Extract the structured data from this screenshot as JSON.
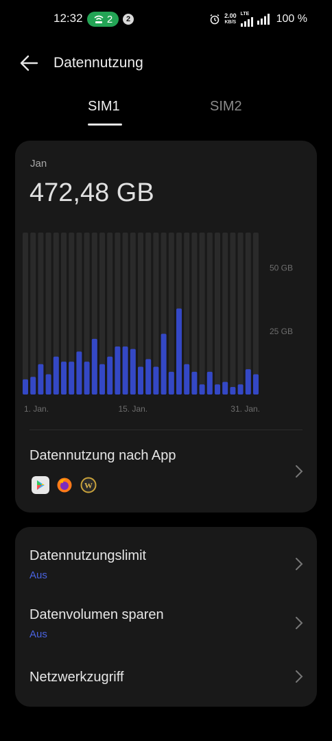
{
  "status_bar": {
    "time": "12:32",
    "hotspot_count": "2",
    "notification_count": "2",
    "speed_value": "2.00",
    "speed_unit": "KB/S",
    "network": "LTE",
    "battery": "100 %"
  },
  "header": {
    "title": "Datennutzung"
  },
  "tabs": [
    {
      "label": "SIM1",
      "selected": true
    },
    {
      "label": "SIM2",
      "selected": false
    }
  ],
  "usage": {
    "month": "Jan",
    "total": "472,48 GB"
  },
  "chart_data": {
    "type": "bar",
    "categories": [
      "1",
      "2",
      "3",
      "4",
      "5",
      "6",
      "7",
      "8",
      "9",
      "10",
      "11",
      "12",
      "13",
      "14",
      "15",
      "16",
      "17",
      "18",
      "19",
      "20",
      "21",
      "22",
      "23",
      "24",
      "25",
      "26",
      "27",
      "28",
      "29",
      "30",
      "31"
    ],
    "values": [
      6,
      7,
      12,
      8,
      15,
      13,
      13,
      17,
      13,
      22,
      12,
      15,
      19,
      19,
      18,
      11,
      14,
      11,
      24,
      9,
      34,
      12,
      9,
      4,
      9,
      4,
      5,
      3,
      4,
      10,
      8
    ],
    "max_value": 64,
    "yticks": [
      {
        "value": 50,
        "label": "50 GB"
      },
      {
        "value": 25,
        "label": "25 GB"
      }
    ],
    "xticks": [
      {
        "day": 1,
        "label": "1. Jan."
      },
      {
        "day": 15,
        "label": "15. Jan."
      },
      {
        "day": 31,
        "label": "31. Jan."
      }
    ],
    "bar_color": "#3448c5",
    "track_color": "#2a2a2a"
  },
  "app_usage": {
    "title": "Datennutzung nach App",
    "apps": [
      "google-play-icon",
      "firefox-icon",
      "world-of-warcraft-icon"
    ]
  },
  "settings": {
    "limit": {
      "title": "Datennutzungslimit",
      "value": "Aus"
    },
    "saver": {
      "title": "Datenvolumen sparen",
      "value": "Aus"
    },
    "network_access": {
      "title": "Netzwerkzugriff"
    }
  },
  "colors": {
    "accent": "#4a63e0",
    "hotspot": "#23a455",
    "card": "#191919"
  }
}
